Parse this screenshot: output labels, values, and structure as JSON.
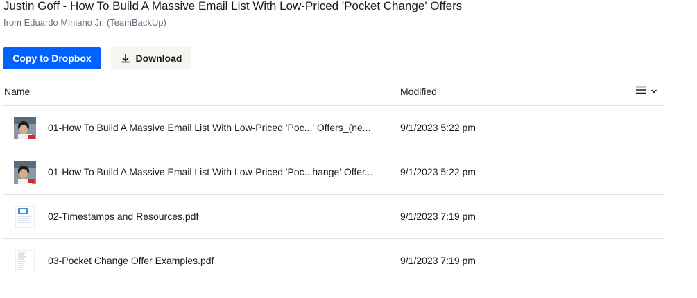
{
  "page": {
    "title": "Justin Goff - How To Build A Massive Email List With Low-Priced 'Pocket Change' Offers",
    "subtitle": "from Eduardo Miniano Jr. (TeamBackUp)"
  },
  "actions": {
    "copy_label": "Copy to Dropbox",
    "download_label": "Download",
    "download_icon": "download-icon"
  },
  "table": {
    "headers": {
      "name": "Name",
      "modified": "Modified"
    },
    "view_icon": "list-view-icon",
    "rows": [
      {
        "name": "01-How To Build A Massive Email List With Low-Priced 'Poc...' Offers_(ne...",
        "modified": "9/1/2023 5:22 pm",
        "thumb": "video-thumbnail"
      },
      {
        "name": "01-How To Build A Massive Email List With Low-Priced 'Poc...hange' Offer...",
        "modified": "9/1/2023 5:22 pm",
        "thumb": "video-thumbnail"
      },
      {
        "name": "02-Timestamps and Resources.pdf",
        "modified": "9/1/2023 7:19 pm",
        "thumb": "pdf-thumbnail"
      },
      {
        "name": "03-Pocket Change Offer Examples.pdf",
        "modified": "9/1/2023 7:19 pm",
        "thumb": "pdf-thumbnail"
      }
    ]
  },
  "colors": {
    "primary": "#0061fe",
    "secondary_bg": "#f7f5f2",
    "text": "#1e1919",
    "muted": "#637282",
    "divider": "#e3e0dc"
  }
}
